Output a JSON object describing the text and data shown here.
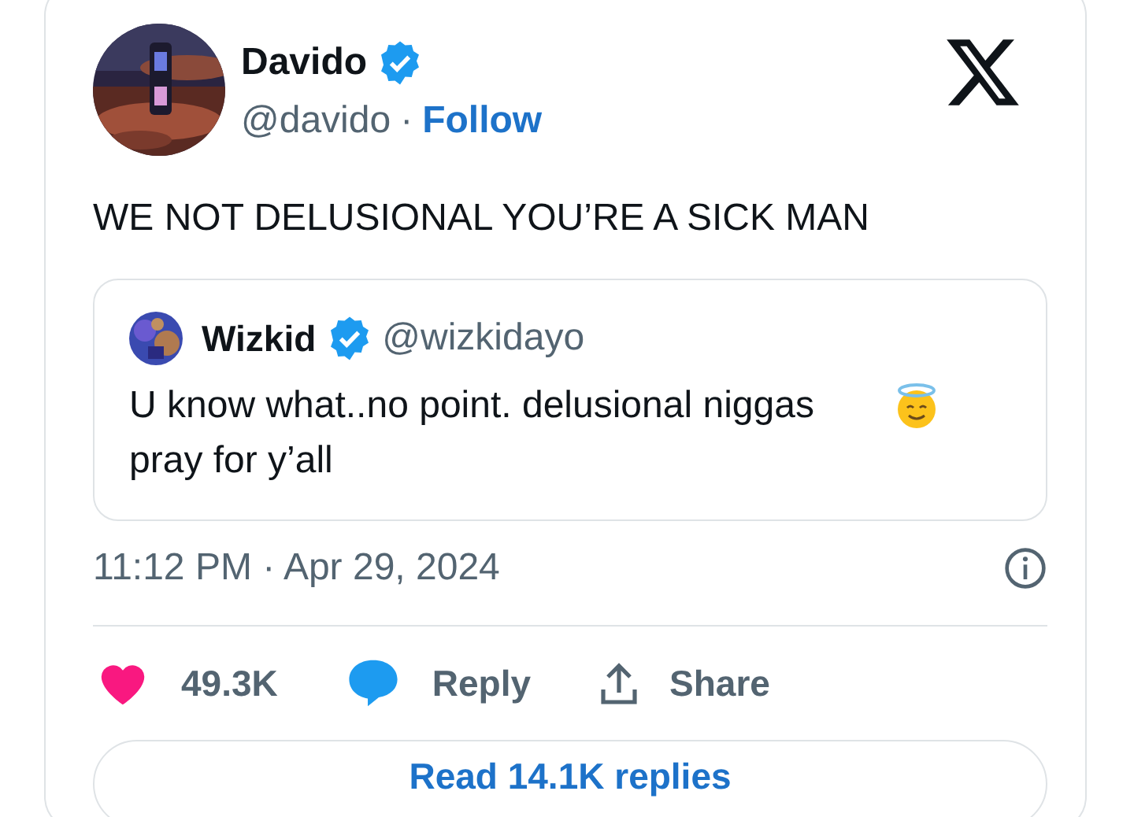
{
  "author": {
    "name": "Davido",
    "verified": true,
    "handle": "@davido",
    "separator": "·",
    "follow": "Follow"
  },
  "text": "WE NOT DELUSIONAL YOU’RE A SICK MAN",
  "quote": {
    "name": "Wizkid",
    "verified": true,
    "handle": "@wizkidayo",
    "text": "U know what..no point. delusional niggas pray for y’all"
  },
  "timestamp": "11:12 PM · Apr 29, 2024",
  "actions": [
    {
      "kind": "like",
      "label": "49.3K"
    },
    {
      "kind": "reply",
      "label": "Reply"
    },
    {
      "kind": "share",
      "label": "Share"
    }
  ],
  "read_replies": "Read 14.1K replies"
}
